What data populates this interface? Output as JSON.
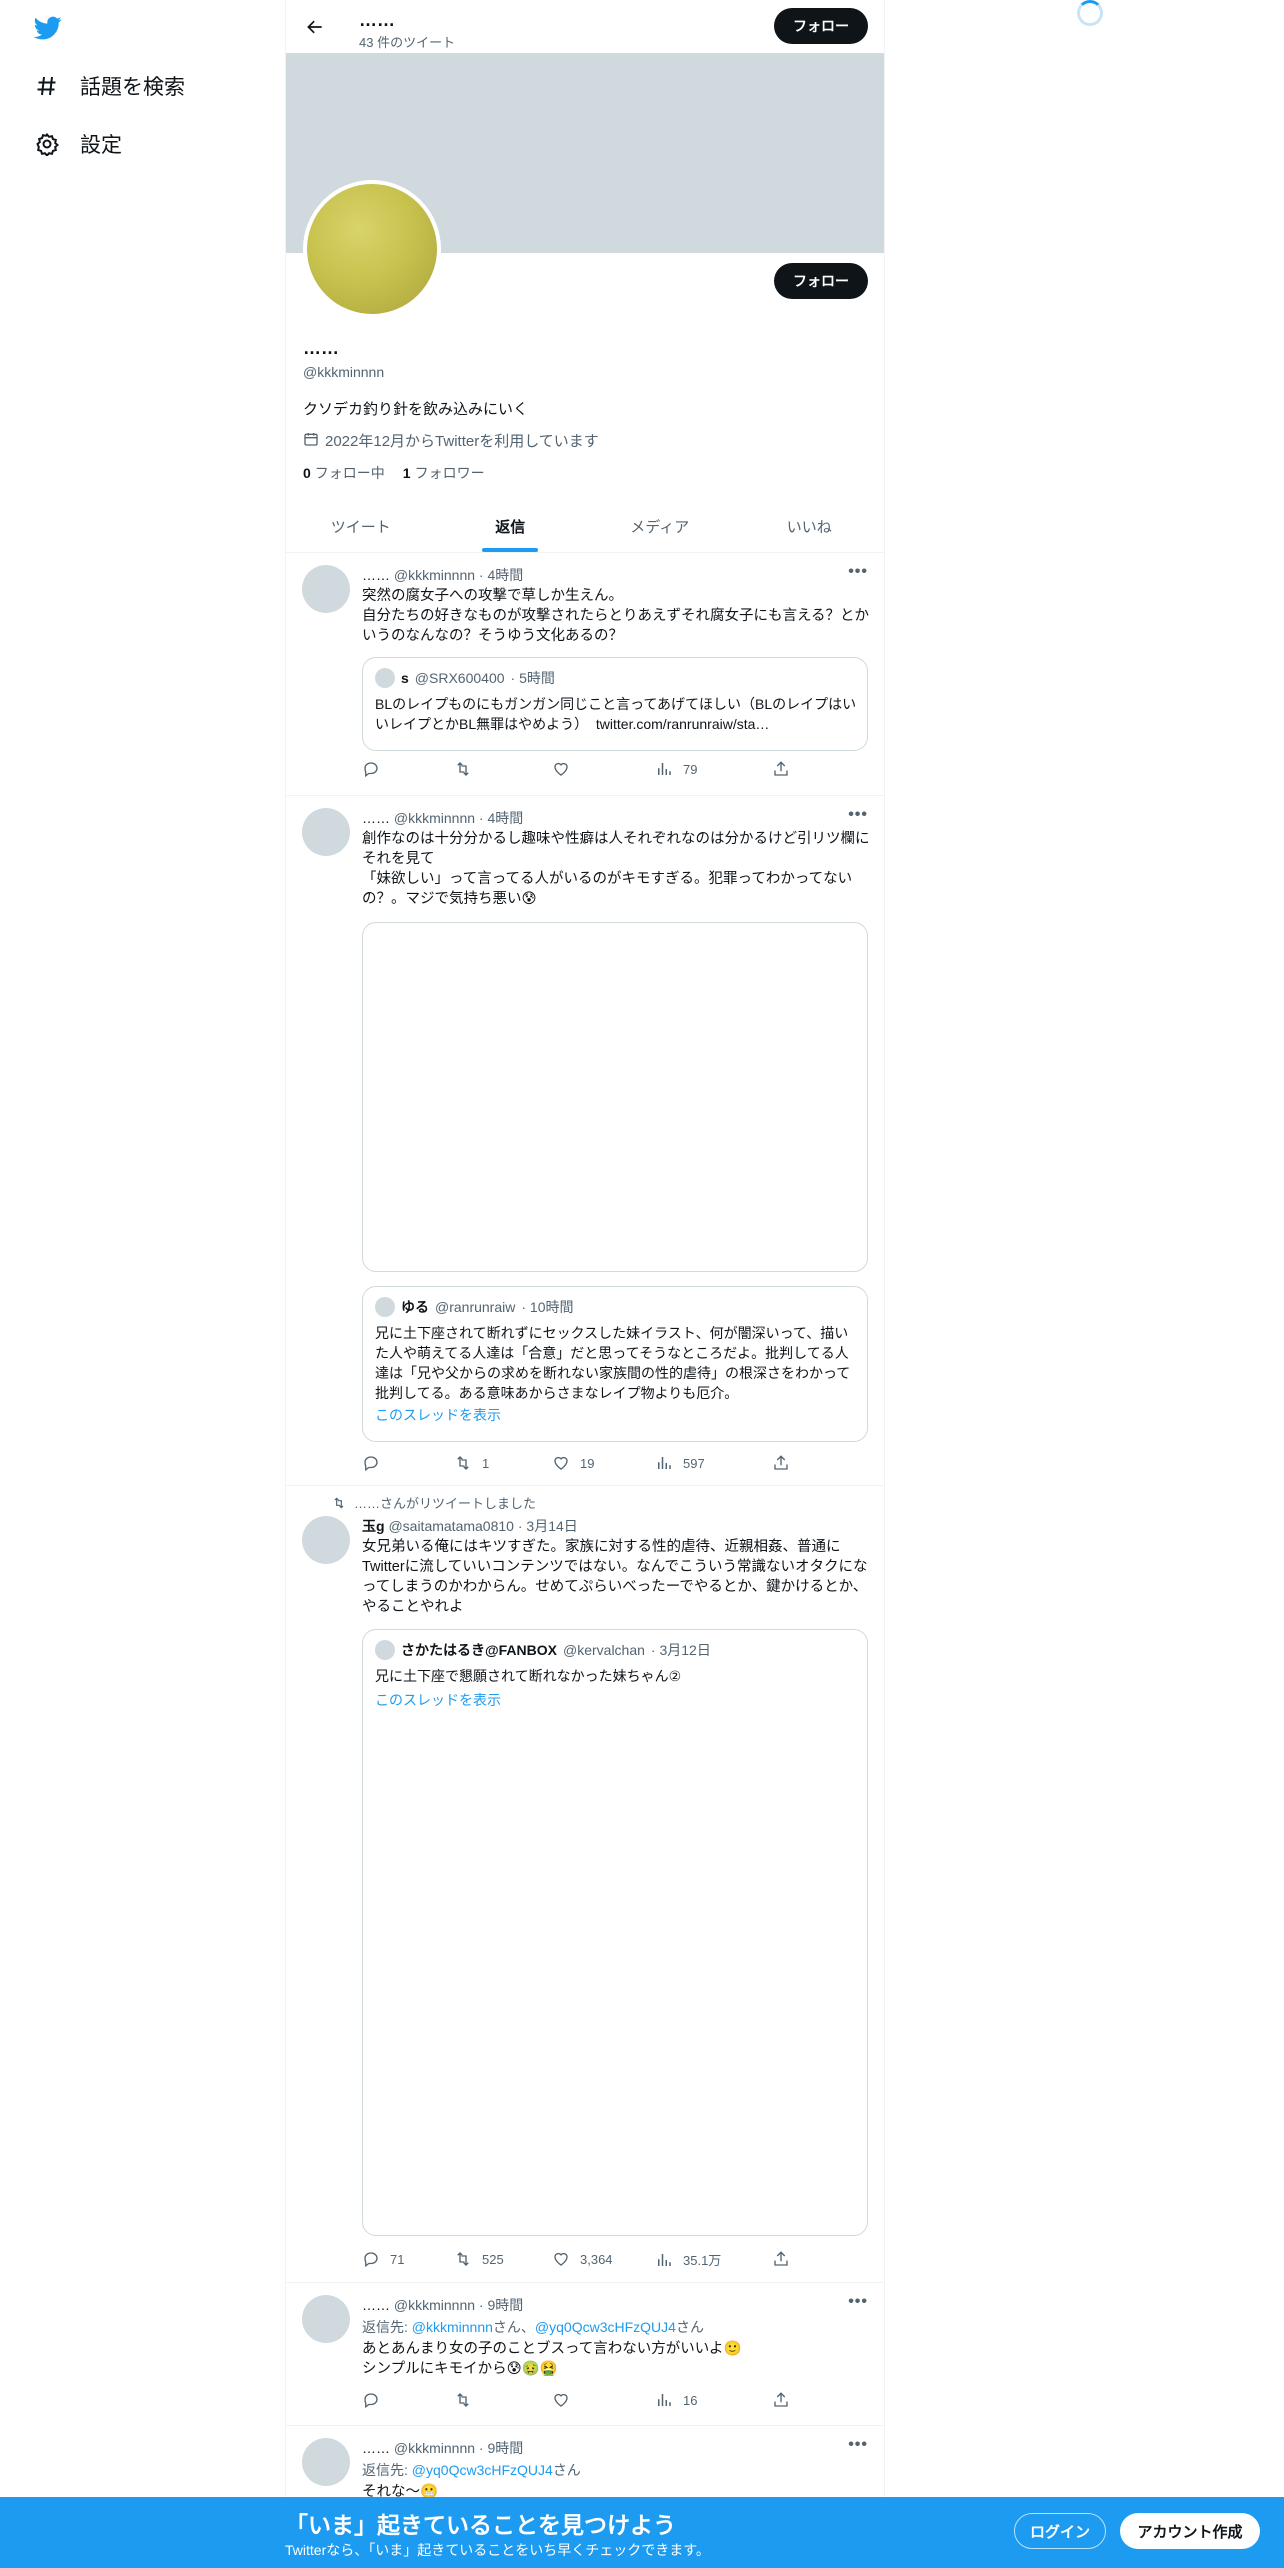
{
  "nav": {
    "items": [
      {
        "label": "話題を検索",
        "icon": "hashtag-icon"
      },
      {
        "label": "設定",
        "icon": "gear-icon"
      }
    ]
  },
  "topbar": {
    "name": "……",
    "tweet_count": "43 件のツイート",
    "follow_label": "フォロー"
  },
  "profile": {
    "follow_label": "フォロー",
    "name": "……",
    "handle": "@kkkminnnn",
    "bio": "クソデカ釣り針を飲み込みにいく",
    "joined": "2022年12月からTwitterを利用しています",
    "following_count": "0",
    "following_label": "フォロー中",
    "followers_count": "1",
    "followers_label": "フォロワー"
  },
  "tabs": [
    {
      "label": "ツイート"
    },
    {
      "label": "返信",
      "active": true
    },
    {
      "label": "メディア"
    },
    {
      "label": "いいね"
    }
  ],
  "tweets": [
    {
      "name": "……",
      "handle": "@kkkminnnn",
      "time": "· 4時間",
      "text": "突然の腐女子への攻撃で草しか生えん。\n自分たちの好きなものが攻撃されたらとりあえずそれ腐女子にも言える？とかいうのなんなの？そうゆう文化あるの？",
      "quote": {
        "name": "s",
        "handle": "@SRX600400",
        "time": "· 5時間",
        "text": "BLのレイプものにもガンガン同じこと言ってあげてほしい（BLのレイプはいいレイプとかBL無罪はやめよう）",
        "link": "twitter.com/ranrunraiw/sta…"
      },
      "stats": {
        "reply": "",
        "retweet": "",
        "like": "",
        "views": "79"
      }
    },
    {
      "name": "……",
      "handle": "@kkkminnnn",
      "time": "· 4時間",
      "text": "創作なのは十分分かるし趣味や性癖は人それぞれなのは分かるけど引リツ欄にそれを見て\n「妹欲しい」って言ってる人がいるのがキモすぎる。犯罪ってわかってないの？。マジで気持ち悪い😰",
      "quote": {
        "name": "ゆる",
        "handle": "@ranrunraiw",
        "time": "· 10時間",
        "text": "兄に土下座されて断れずにセックスした妹イラスト、何が闇深いって、描いた人や萌えてる人達は「合意」だと思ってそうなところだよ。批判してる人達は「兄や父からの求めを断れない家族間の性的虐待」の根深さをわかって批判してる。ある意味あからさまなレイプ物よりも厄介。",
        "link": "このスレッドを表示"
      },
      "stats": {
        "reply": "",
        "retweet": "1",
        "like": "19",
        "views": "597"
      }
    },
    {
      "retweet_note": "……さんがリツイートしました",
      "name": "玉g",
      "handle": "@saitamatama0810",
      "time": "· 3月14日",
      "text": "女兄弟いる俺にはキツすぎた。家族に対する性的虐待、近親相姦、普通にTwitterに流していいコンテンツではない。なんでこういう常識ないオタクになってしまうのかわからん。せめてぷらいべったーでやるとか、鍵かけるとか、やることやれよ",
      "quote": {
        "name": "さかたはるき@FANBOX",
        "handle": "@kervalchan",
        "time": "· 3月12日",
        "text": "兄に土下座で懇願されて断れなかった妹ちゃん②",
        "link": "このスレッドを表示"
      },
      "stats": {
        "reply": "71",
        "retweet": "525",
        "like": "3,364",
        "views": "35.1万"
      }
    },
    {
      "name": "……",
      "handle": "@kkkminnnn",
      "time": "· 9時間",
      "reply_prefix": "返信先: ",
      "reply_to_1": "@kkkminnnn",
      "reply_mid": "さん、",
      "reply_to_2": "@yq0Qcw3cHFzQUJ4",
      "reply_suffix": "さん",
      "text": "あとあんまり女の子のことブスって言わない方がいいよ🙂\nシンプルにキモイから😰🤢🤮",
      "stats": {
        "reply": "",
        "retweet": "",
        "like": "",
        "views": "16"
      }
    },
    {
      "name": "……",
      "handle": "@kkkminnnn",
      "time": "· 9時間",
      "reply_prefix": "返信先: ",
      "reply_to_1": "@yq0Qcw3cHFzQUJ4",
      "reply_suffix": "さん",
      "text": "それな〜😬"
    }
  ],
  "bottom_bar": {
    "title": "「いま」起きていることを見つけよう",
    "subtitle": "Twitterなら、「いま」起きていることをいち早くチェックできます。",
    "login_label": "ログイン",
    "signup_label": "アカウント作成"
  }
}
